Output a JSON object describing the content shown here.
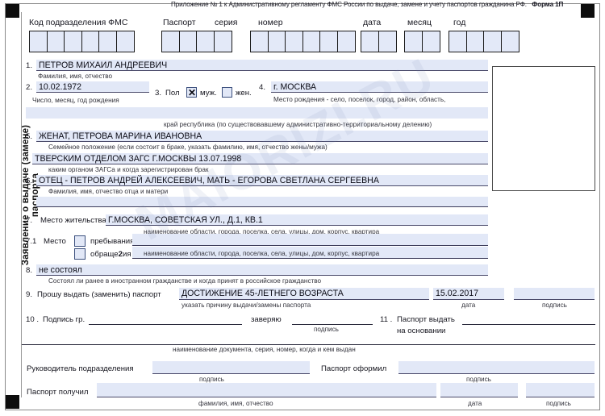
{
  "document": {
    "header_note": "Приложение № 1 к Административному регламенту ФМС России по выдаче, замене и учету паспортов гражданина РФ.",
    "form_code": "Форма 1П",
    "vertical_title": "Заявление о выдаче (замене) паспорта",
    "watermark": "MAIORIZI.RU"
  },
  "code_row": {
    "label_division_code": "Код подразделения ФМС",
    "label_passport": "Паспорт",
    "label_series": "серия",
    "label_number": "номер",
    "label_day": "дата",
    "label_month": "месяц",
    "label_year": "год",
    "cells_division_code": 6,
    "cells_series": 4,
    "cells_number": 6,
    "cells_day": 2,
    "cells_month": 2,
    "cells_year": 4
  },
  "fields": [
    {
      "num": "1.",
      "value": "ПЕТРОВ МИХАИЛ АНДРЕЕВИЧ",
      "hint": "Фамилия, имя, отчество"
    },
    {
      "num": "2.",
      "value": "10.02.1972",
      "hint": "Число, месяц, год рождения"
    },
    {
      "num": "3.",
      "label": "Пол",
      "option_male": "муж.",
      "option_female": "жен.",
      "male_checked": true,
      "female_checked": false
    },
    {
      "num": "4.",
      "value": "г. МОСКВА",
      "hint": "Место рождения - село, поселок, город, район, область,",
      "hint2": "край республика (по существовавшему административно-территориальному делению)"
    },
    {
      "num": "5.",
      "value": "ЖЕНАТ, ПЕТРОВА МАРИНА ИВАНОВНА",
      "hint": "Семейное положение (если состоит в браке, указать фамилию, имя, отчество жены/мужа)",
      "value2": "ТВЕРСКИМ ОТДЕЛОМ ЗАГС Г.МОСКВЫ 13.07.1998",
      "hint2": "каким органом ЗАГСа и когда зарегистрирован брак"
    },
    {
      "num": "6.",
      "value": "ОТЕЦ - ПЕТРОВ АНДРЕЙ АЛЕКСЕЕВИЧ, МАТЬ - ЕГОРОВА СВЕТЛАНА СЕРГЕЕВНА",
      "hint": "Фамилия, имя, отчество отца и матери"
    },
    {
      "num": "7.",
      "label": "Место жительства",
      "value": "Г.МОСКВА, СОВЕТСКАЯ УЛ., Д.1, КВ.1",
      "hint": "наименование области, города, поселка, села, улицы, дом, корпус, квартира"
    },
    {
      "num": "7.1",
      "label": "Место",
      "option_stay": "пребывания",
      "option_appeal": "обраще",
      "option_appeal_sup": "2",
      "option_appeal_tail": "ия",
      "hint": "наименование области, города, поселка, села, улицы, дом, корпус, квартира"
    },
    {
      "num": "8.",
      "value": "не состоял",
      "hint": "Состоял ли ранее в иностранном гражданстве и когда принят в российское гражданство"
    },
    {
      "num": "9.",
      "label": "Прошу выдать (заменить) паспорт",
      "value": "ДОСТИЖЕНИЕ 45-ЛЕТНЕГО ВОЗРАСТА",
      "hint": "указать причину выдачи/замены паспорта",
      "date_value": "15.02.2017",
      "hint_date": "дата",
      "hint_sign": "подпись"
    },
    {
      "num": "10 .",
      "label": "Подпись гр.",
      "certify": "заверяю",
      "hint_sign": "подпись"
    },
    {
      "num": "11 .",
      "label_line1": "Паспорт выдать",
      "label_line2": "на основании",
      "hint": "наименование документа, серия, номер, когда и кем выдан"
    }
  ],
  "footer": {
    "head_label": "Руководитель подразделения",
    "head_hint": "подпись",
    "issued_label": "Паспорт оформил",
    "issued_hint": "подпись",
    "received_label": "Паспорт получил",
    "received_hint": "фамилия, имя, отчество",
    "date_hint": "дата",
    "sign_hint": "подпись"
  },
  "colors": {
    "field_fill": "#e2e8f7",
    "cell_fill": "#e3e9f8",
    "frame": "#8a8a8a",
    "text": "#16161f"
  }
}
